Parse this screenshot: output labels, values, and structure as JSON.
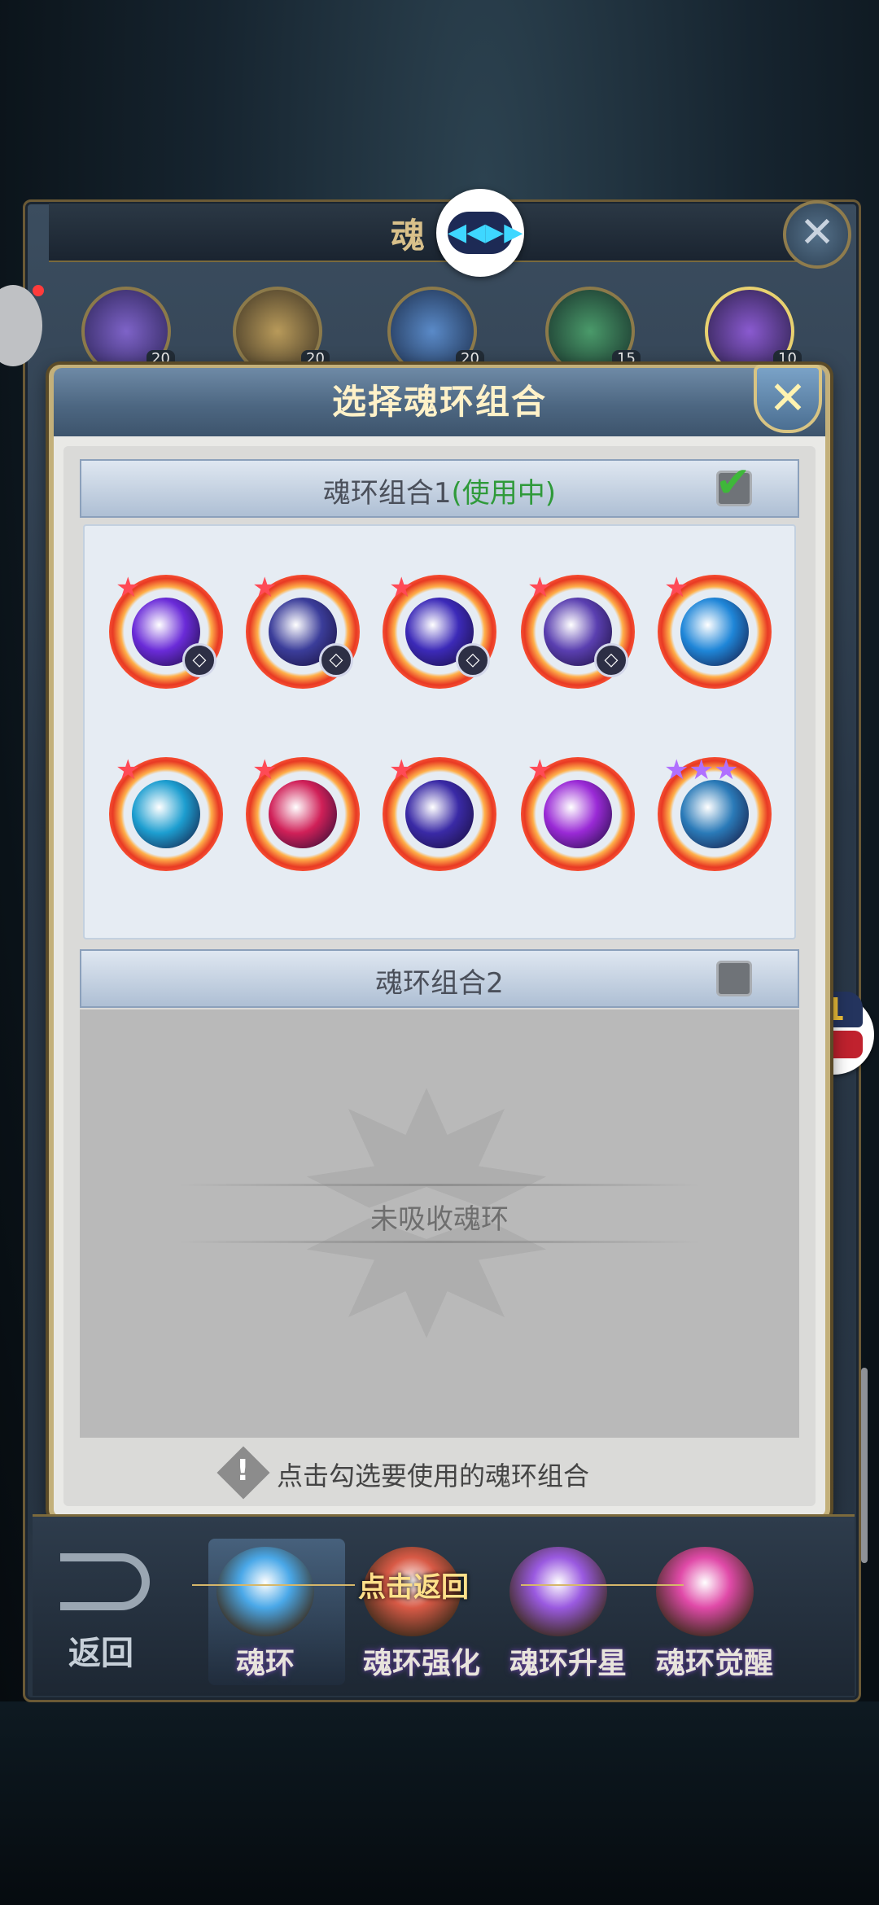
{
  "outer_window": {
    "title": "魂",
    "close_icon": "✕",
    "hero_levels": [
      "20",
      "20",
      "20",
      "15",
      "10"
    ]
  },
  "logo": {
    "glyph": "◀◀▶▶"
  },
  "side_notification": {
    "badge": "1"
  },
  "dialog": {
    "title": "选择魂环组合",
    "close_icon": "✕",
    "groups": [
      {
        "label": "魂环组合1",
        "status": "(使用中)",
        "checked": true
      },
      {
        "label": "魂环组合2",
        "checked": false
      }
    ],
    "empty_message": "未吸收魂环",
    "hint": "点击勾选要使用的魂环组合"
  },
  "soul_rings": [
    {
      "color": "#6a2bd8",
      "star": "★",
      "badge": true
    },
    {
      "color": "#3b3d9a",
      "star": "★",
      "badge": true
    },
    {
      "color": "#3c2ab8",
      "star": "★",
      "badge": true
    },
    {
      "color": "#5a3fb0",
      "star": "★",
      "badge": true
    },
    {
      "color": "#1f86d8",
      "star": "★",
      "badge": false
    },
    {
      "color": "#1d9ed0",
      "star": "★",
      "badge": false
    },
    {
      "color": "#d02058",
      "star": "★",
      "badge": false
    },
    {
      "color": "#3a2aa6",
      "star": "★",
      "badge": false
    },
    {
      "color": "#9a2ad6",
      "star": "★",
      "badge": false
    },
    {
      "color": "#2a7ab8",
      "star": "★★★",
      "badge": false
    }
  ],
  "bottom_menu": {
    "back_label": "返回",
    "tip": "点击返回",
    "tabs": [
      {
        "label": "魂环",
        "color": "#4aa8e8"
      },
      {
        "label": "魂环强化",
        "color": "#d85a46"
      },
      {
        "label": "魂环升星",
        "color": "#9a5ae0"
      },
      {
        "label": "魂环觉醒",
        "color": "#e04aa8"
      }
    ]
  }
}
